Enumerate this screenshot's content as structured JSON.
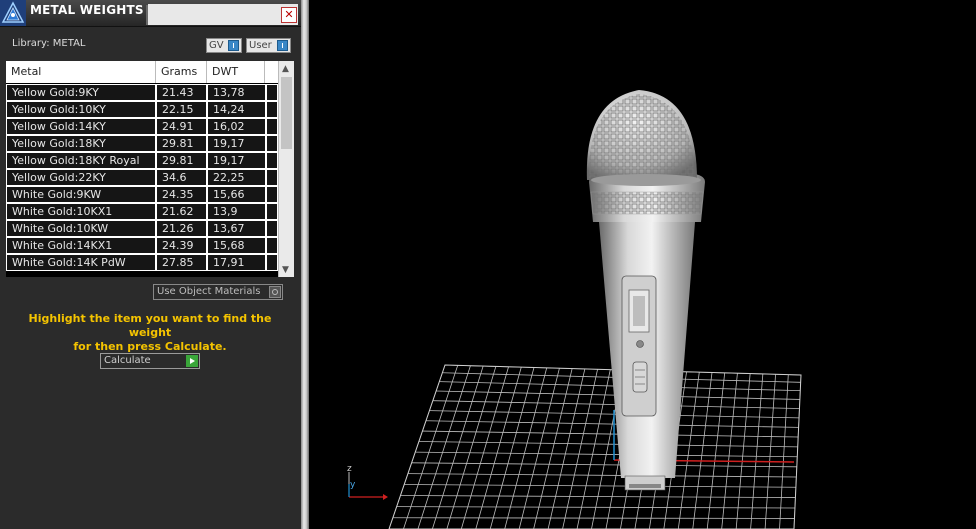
{
  "window": {
    "title": "METAL WEIGHTS",
    "close_glyph": "✕"
  },
  "library": {
    "label": "Library: METAL"
  },
  "toggles": {
    "gv": "GV",
    "user": "User"
  },
  "table": {
    "columns": [
      "Metal",
      "Grams",
      "DWT"
    ],
    "rows": [
      [
        "Yellow Gold:9KY",
        "21.43",
        "13,78"
      ],
      [
        "Yellow Gold:10KY",
        "22.15",
        "14,24"
      ],
      [
        "Yellow Gold:14KY",
        "24.91",
        "16,02"
      ],
      [
        "Yellow Gold:18KY",
        "29.81",
        "19,17"
      ],
      [
        "Yellow Gold:18KY Royal",
        "29.81",
        "19,17"
      ],
      [
        "Yellow Gold:22KY",
        "34.6",
        "22,25"
      ],
      [
        "White Gold:9KW",
        "24.35",
        "15,66"
      ],
      [
        "White Gold:10KX1",
        "21.62",
        "13,9"
      ],
      [
        "White Gold:10KW",
        "21.26",
        "13,67"
      ],
      [
        "White Gold:14KX1",
        "24.39",
        "15,68"
      ],
      [
        "White Gold:14K PdW",
        "27.85",
        "17,91"
      ]
    ]
  },
  "use_object_materials": "Use Object Materials",
  "hint": {
    "line1": "Highlight the item you want to find the weight",
    "line2": "for then press Calculate."
  },
  "calculate": {
    "label": "Calculate"
  },
  "viewport": {
    "axes": {
      "z": "z",
      "y": "y"
    }
  },
  "icons": {
    "app": "pyramid-logo-icon",
    "close": "close-icon",
    "gv_toggle": "toggle-icon",
    "user_toggle": "toggle-icon",
    "scroll_up": "arrow-up-icon",
    "scroll_down": "arrow-down-icon",
    "use_object": "radio-icon",
    "calculate": "play-arrow-icon"
  },
  "colors": {
    "hint": "#f5c400",
    "toggle_knob": "#3a87c6",
    "calc_arrow": "#3aa63a",
    "axis_x": "#d02020",
    "axis_y": "#2090d0"
  }
}
